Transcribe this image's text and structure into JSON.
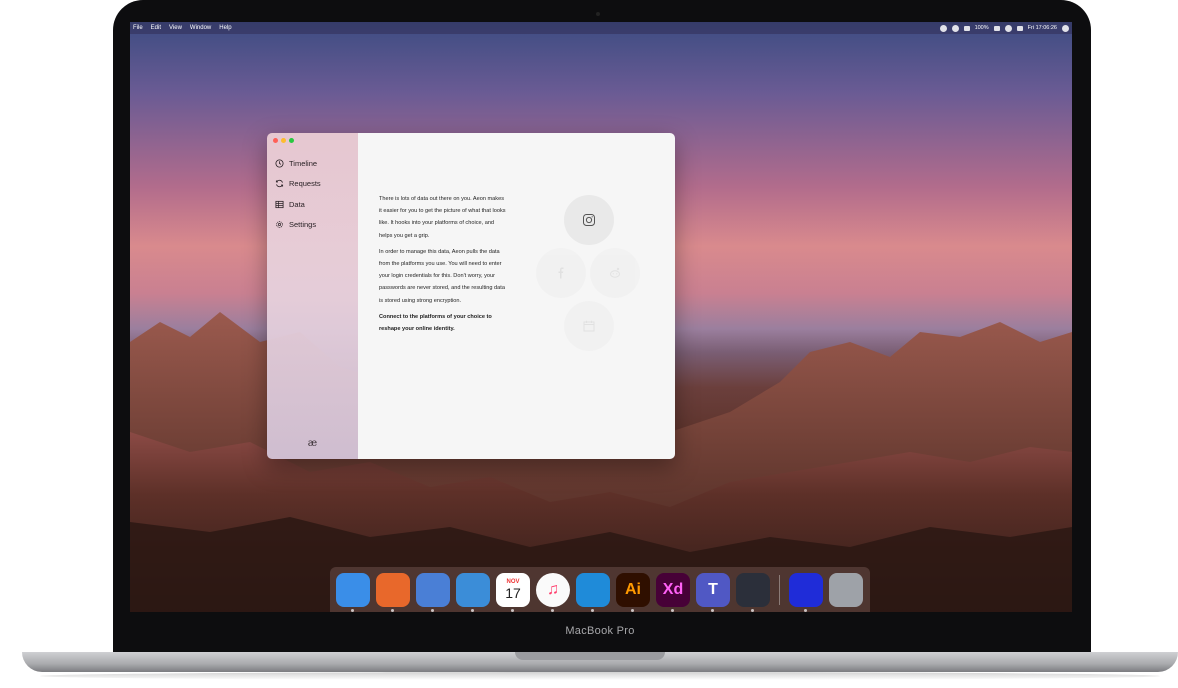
{
  "menubar": {
    "items": [
      "File",
      "Edit",
      "View",
      "Window",
      "Help"
    ],
    "battery": "100%",
    "clock": "Fri 17:06:26"
  },
  "sidebar": {
    "items": [
      {
        "label": "Timeline",
        "icon": "clock-icon"
      },
      {
        "label": "Requests",
        "icon": "refresh-icon"
      },
      {
        "label": "Data",
        "icon": "table-icon"
      },
      {
        "label": "Settings",
        "icon": "gear-icon"
      }
    ],
    "logo": "æ"
  },
  "content": {
    "paragraph1": "There is lots of data out there on you. Aeon makes it easier for you to get the picture of what that looks like. It hooks into your platforms of choice, and helps you get a grip.",
    "paragraph2": "In order to manage this data, Aeon pulls the data from the platforms you use. You will need to enter your login credentials for this. Don't worry, your passwords are never stored, and the resulting data is stored using strong encryption.",
    "cta": "Connect to the platforms of your choice to reshape your online identity."
  },
  "platforms": [
    "instagram-icon",
    "facebook-icon",
    "reddit-icon",
    "calendar-icon"
  ],
  "dock": {
    "apps": [
      {
        "name": "finder",
        "label": "",
        "color": "#3a8ee8"
      },
      {
        "name": "firefox",
        "label": "",
        "color": "#e8682b"
      },
      {
        "name": "app-3",
        "label": "",
        "color": "#4a7fd6"
      },
      {
        "name": "app-4",
        "label": "",
        "color": "#3b8dd8"
      },
      {
        "name": "calendar",
        "label": "17",
        "month": "NOV",
        "color": "#ffffff"
      },
      {
        "name": "music",
        "label": "♫",
        "color": "#fafafa"
      },
      {
        "name": "vscode",
        "label": "",
        "color": "#1f8bd9"
      },
      {
        "name": "illustrator",
        "label": "Ai",
        "color": "#2f0f00"
      },
      {
        "name": "xd",
        "label": "Xd",
        "color": "#470137"
      },
      {
        "name": "teams",
        "label": "T",
        "color": "#5058c4"
      },
      {
        "name": "electron",
        "label": "",
        "color": "#2b2f3a"
      },
      {
        "name": "app-12",
        "label": "",
        "color": "#1f2cd8"
      },
      {
        "name": "trash",
        "label": "",
        "color": "#9ea2a8"
      }
    ]
  },
  "laptop": {
    "label": "MacBook Pro"
  }
}
